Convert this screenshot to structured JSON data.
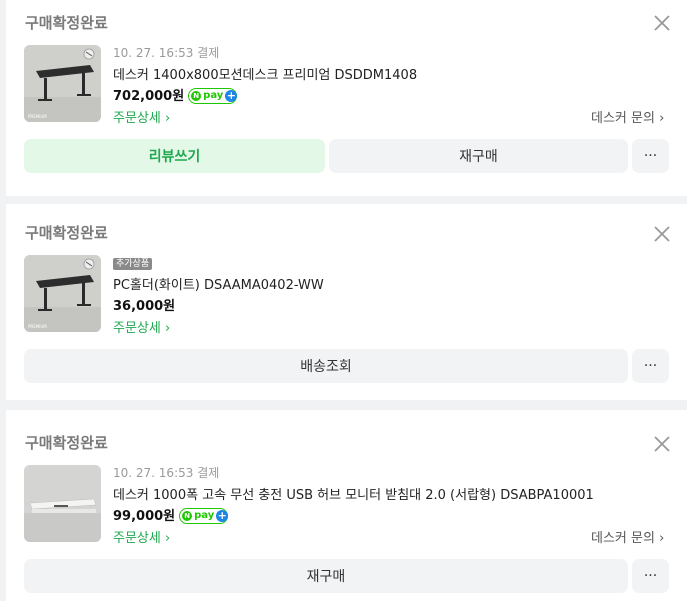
{
  "orders": [
    {
      "status": "구매확정완료",
      "meta": "10. 27. 16:53 결제",
      "product_name": "데스커 1400x800모션데스크 프리미엄 DSDDM1408",
      "price": "702,000원",
      "npay_label": "pay",
      "detail_link": "주문상세",
      "inquiry_link": "데스커 문의",
      "review_button": "리뷰쓰기",
      "reorder_button": "재구매",
      "thumb_text": "PREMIUM"
    },
    {
      "status": "구매확정완료",
      "badge": "추가상품",
      "product_name": "PC홀더(화이트) DSAAMA0402-WW",
      "price": "36,000원",
      "detail_link": "주문상세",
      "delivery_button": "배송조회",
      "thumb_text": "PREMIUM"
    },
    {
      "status": "구매확정완료",
      "meta": "10. 27. 16:53 결제",
      "product_name": "데스커 1000폭 고속 무선 충전 USB 허브 모니터 받침대 2.0 (서랍형) DSABPA10001",
      "price": "99,000원",
      "npay_label": "pay",
      "detail_link": "주문상세",
      "inquiry_link": "데스커 문의",
      "reorder_button": "재구매"
    }
  ],
  "more_label": "···",
  "icons": {
    "close": "close-icon",
    "chevron": "chevron-right-icon",
    "more": "more-dots-icon"
  },
  "colors": {
    "accent_green": "#1fa84f",
    "npay_green": "#1ec800"
  }
}
